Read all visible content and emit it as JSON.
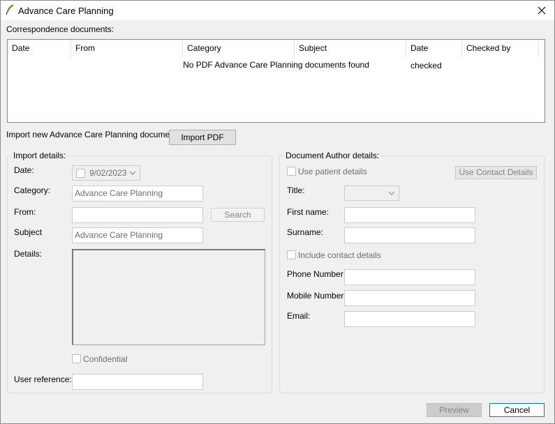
{
  "window": {
    "title": "Advance Care Planning",
    "close_icon": "close-icon",
    "app_icon": "feather-pen-icon"
  },
  "correspondence": {
    "label": "Correspondence documents:",
    "columns": [
      "Date",
      "From",
      "Category",
      "Subject",
      "Date checked",
      "Checked by"
    ],
    "empty_message": "No PDF Advance Care Planning documents found"
  },
  "import_new": {
    "label": "Import new Advance Care Planning document",
    "button": "Import PDF"
  },
  "import_details": {
    "title": "Import details:",
    "date_label": "Date:",
    "date_value": "9/02/2023",
    "date_checked": false,
    "category_label": "Category:",
    "category_value": "Advance Care Planning",
    "from_label": "From:",
    "from_value": "",
    "search_button": "Search",
    "subject_label": "Subject",
    "subject_value": "Advance Care Planning",
    "details_label": "Details:",
    "details_value": "",
    "confidential_label": "Confidential",
    "confidential_checked": false,
    "user_reference_label": "User reference:",
    "user_reference_value": ""
  },
  "author_details": {
    "title": "Document Author details:",
    "use_patient_label": "Use patient details",
    "use_patient_checked": false,
    "use_contact_button": "Use Contact Details",
    "title_label": "Title:",
    "title_value": "",
    "first_name_label": "First name:",
    "first_name_value": "",
    "surname_label": "Surname:",
    "surname_value": "",
    "include_contact_label": "Include contact details",
    "include_contact_checked": false,
    "phone_label": "Phone Number:",
    "phone_value": "",
    "mobile_label": "Mobile Number:",
    "mobile_value": "",
    "email_label": "Email:",
    "email_value": ""
  },
  "footer": {
    "preview_button": "Preview",
    "cancel_button": "Cancel"
  }
}
